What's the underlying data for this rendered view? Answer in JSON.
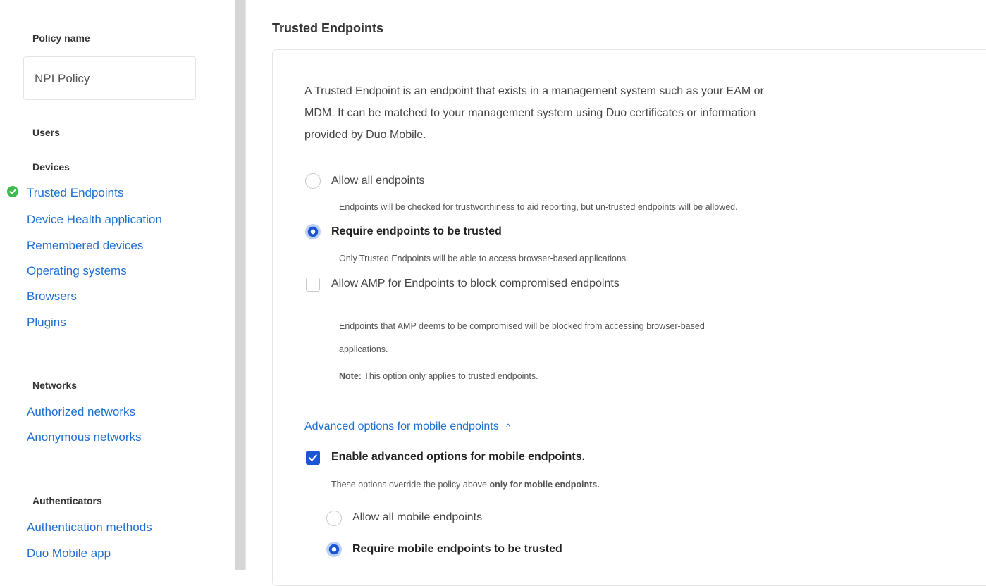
{
  "sidebar": {
    "policy_name_heading": "Policy name",
    "policy_name_value": "NPI Policy",
    "users_heading": "Users",
    "devices_heading": "Devices",
    "devices_items": [
      {
        "label": "Trusted Endpoints",
        "complete": true
      },
      {
        "label": "Device Health application"
      },
      {
        "label": "Remembered devices"
      },
      {
        "label": "Operating systems"
      },
      {
        "label": "Browsers"
      },
      {
        "label": "Plugins"
      }
    ],
    "networks_heading": "Networks",
    "networks_items": [
      {
        "label": "Authorized networks"
      },
      {
        "label": "Anonymous networks"
      }
    ],
    "authenticators_heading": "Authenticators",
    "authenticators_items": [
      {
        "label": "Authentication methods"
      },
      {
        "label": "Duo Mobile app"
      }
    ]
  },
  "main": {
    "title": "Trusted Endpoints",
    "description_lines": [
      "A Trusted Endpoint is an endpoint that exists in a management system such as your EAM or",
      "MDM. It can be matched to your management system using Duo certificates or information",
      "provided by Duo Mobile."
    ],
    "options": {
      "allow_all": {
        "label": "Allow all endpoints",
        "help": "Endpoints will be checked for trustworthiness to aid reporting, but un-trusted endpoints will be allowed.",
        "selected": false
      },
      "require_trusted": {
        "label": "Require endpoints to be trusted",
        "help": "Only Trusted Endpoints will be able to access browser-based applications.",
        "selected": true
      },
      "amp": {
        "label": "Allow AMP for Endpoints to block compromised endpoints",
        "help_line1": "Endpoints that AMP deems to be compromised will be blocked from accessing browser-based",
        "help_line2": "applications.",
        "note_label": "Note:",
        "note_text": " This option only applies to trusted endpoints.",
        "checked": false
      }
    },
    "advanced": {
      "link_label": "Advanced options for mobile endpoints",
      "chevron": "^",
      "enable_label": "Enable advanced options for mobile endpoints.",
      "enable_checked": true,
      "enable_help_prefix": "These options override the policy above ",
      "enable_help_bold": "only for mobile endpoints.",
      "allow_all_mobile": {
        "label": "Allow all mobile endpoints",
        "selected": false
      },
      "require_mobile": {
        "label": "Require mobile endpoints to be trusted",
        "selected": true
      }
    }
  },
  "colors": {
    "link": "#1f6fd1",
    "accent": "#1a55d6",
    "success": "#3fb950"
  }
}
